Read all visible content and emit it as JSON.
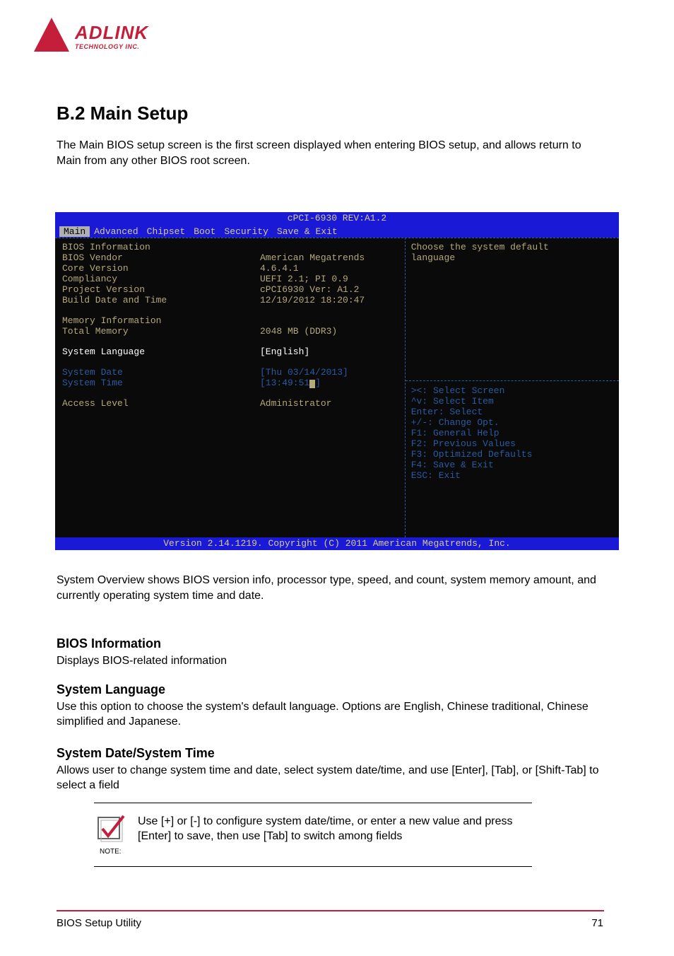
{
  "logo": {
    "main": "ADLINK",
    "sub": "TECHNOLOGY INC."
  },
  "section_title": "B.2 Main Setup",
  "para1": "The Main BIOS setup screen is the first screen displayed when entering BIOS setup, and allows return to Main from any other BIOS root screen.",
  "bios": {
    "header": "cPCI-6930 REV:A1.2",
    "tabs": [
      "Main",
      "Advanced",
      "Chipset",
      "Boot",
      "Security",
      "Save & Exit"
    ],
    "rows": [
      {
        "label": "BIOS Information",
        "value": ""
      },
      {
        "label": "BIOS Vendor",
        "value": "American Megatrends"
      },
      {
        "label": "Core Version",
        "value": "4.6.4.1"
      },
      {
        "label": "Compliancy",
        "value": "UEFI 2.1; PI 0.9"
      },
      {
        "label": "Project Version",
        "value": "cPCI6930 Ver: A1.2"
      },
      {
        "label": "Build Date and Time",
        "value": "12/19/2012 18:20:47"
      }
    ],
    "mem_header": "Memory Information",
    "mem_label": "Total Memory",
    "mem_value": "2048 MB (DDR3)",
    "syslang_label": "System Language",
    "syslang_value": "[English]",
    "sysdate_label": "System Date",
    "sysdate_value": "[Thu 03/14/2013]",
    "systime_label": "System Time",
    "systime_value": "[13:49:51",
    "access_label": "Access Level",
    "access_value": "Administrator",
    "help_top1": "Choose the system default",
    "help_top2": "language",
    "help_lines": [
      "><: Select Screen",
      "^v: Select Item",
      "Enter: Select",
      "+/-: Change Opt.",
      "F1: General Help",
      "F2: Previous Values",
      "F3: Optimized Defaults",
      "F4: Save & Exit",
      "ESC: Exit"
    ],
    "footer": "Version 2.14.1219. Copyright (C) 2011 American Megatrends, Inc."
  },
  "para2": "System Overview shows BIOS version info, processor type, speed, and count, system memory amount, and currently operating system time and date.",
  "h_bios": "BIOS Information",
  "p_bios": "Displays BIOS-related information",
  "h_lang": "System Language",
  "p_lang": "Use this option to choose the system's default language. Options are English, Chinese traditional, Chinese simplified and Japanese.",
  "h_date": "System Date/System Time",
  "p_date": "Allows user to change system time and date, select system date/time, and use [Enter], [Tab], or [Shift-Tab] to select a field",
  "note_label": "NOTE:",
  "note_text": "Use [+] or [-] to configure system date/time, or enter a new value and press [Enter] to save, then use [Tab] to switch among fields",
  "footer_left": "BIOS Setup Utility",
  "footer_right": "71"
}
